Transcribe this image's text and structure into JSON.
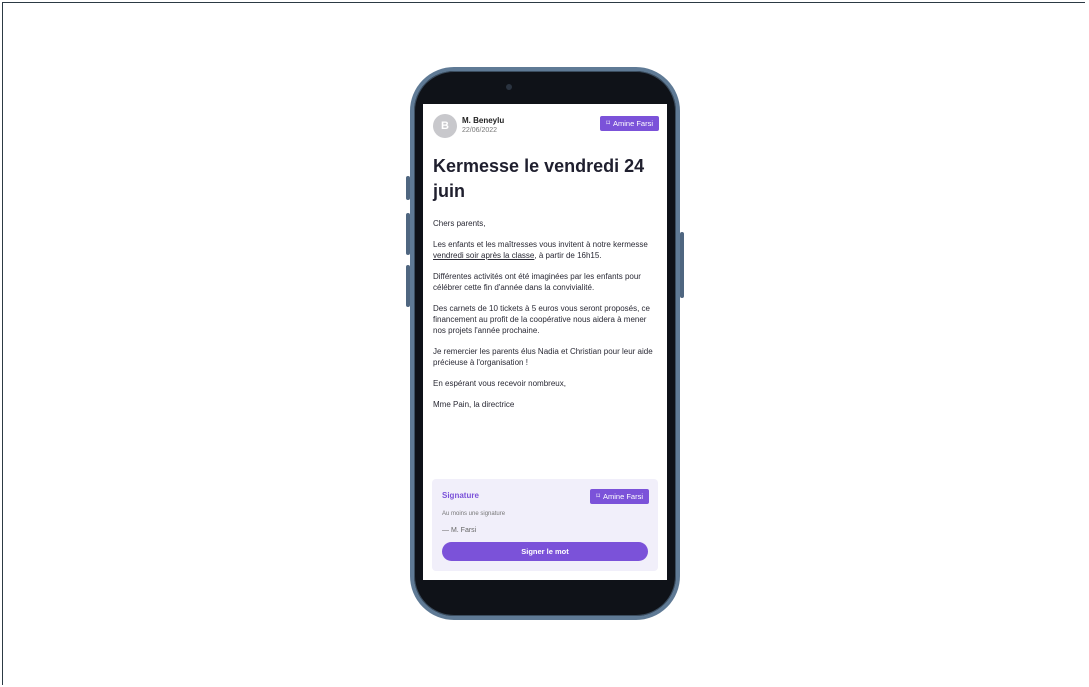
{
  "post": {
    "avatar_letter": "B",
    "author": "M. Beneylu",
    "date": "22/06/2022",
    "badge_label": "Amine Farsi",
    "title": "Kermesse le vendredi 24 juin",
    "greeting": "Chers parents,",
    "p1_before": "Les enfants et les maîtresses vous invitent à notre kermesse ",
    "p1_underlined": "vendredi soir après la classe",
    "p1_after": ", à partir de 16h15.",
    "p2": "Différentes activités ont été imaginées par les enfants pour célébrer cette fin d'année dans la convivialité.",
    "p3": "Des carnets de 10 tickets à 5 euros vous seront proposés, ce financement au profit de la coopérative nous aidera à mener nos projets l'année prochaine.",
    "p4": "Je remercier les parents élus Nadia et Christian pour leur aide précieuse à l'organisation !",
    "p5": "En espérant vous recevoir nombreux,",
    "p6": "Mme Pain, la directrice"
  },
  "signature": {
    "title": "Signature",
    "badge_label": "Amine Farsi",
    "note": "Au moins une signature",
    "signer": "— M. Farsi",
    "button_label": "Signer le mot"
  },
  "colors": {
    "accent": "#7b52d9",
    "card_bg": "#f1effa",
    "phone_frame": "#5f7a95"
  }
}
